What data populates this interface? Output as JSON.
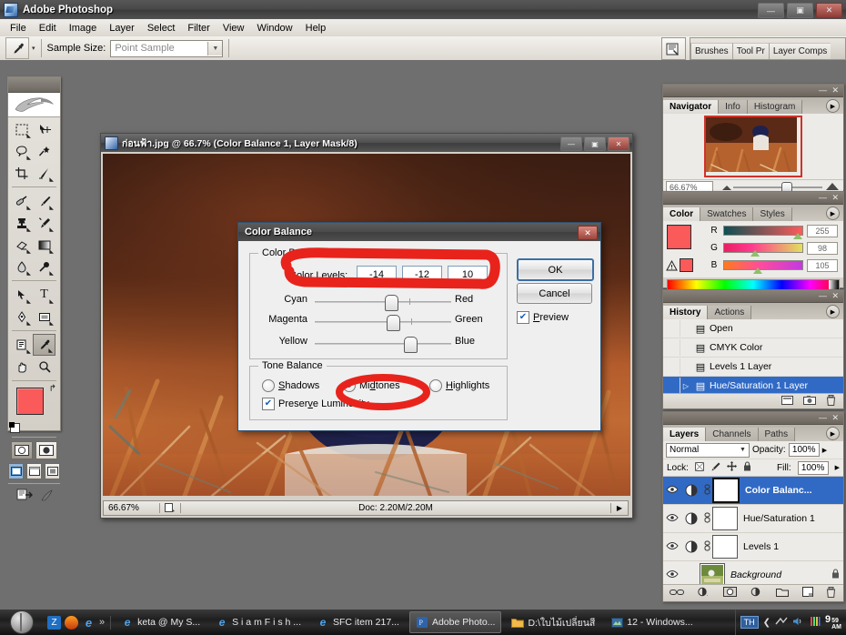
{
  "window": {
    "title": "Adobe Photoshop",
    "icon": "photoshop-icon",
    "minimize": "—",
    "maximize": "▣",
    "close": "✕"
  },
  "menu": {
    "items": [
      "File",
      "Edit",
      "Image",
      "Layer",
      "Select",
      "Filter",
      "View",
      "Window",
      "Help"
    ]
  },
  "options_bar": {
    "tool_icon": "eyedropper-icon",
    "tool_dropdown": "▾",
    "sample_size_label": "Sample Size:",
    "sample_size_value": "Point Sample",
    "dropdown_arrow": "▼"
  },
  "palette_well": {
    "icon": "palette-well-icon",
    "tabs": [
      "Brushes",
      "Tool Pr",
      "Layer Comps"
    ]
  },
  "toolbox": {
    "logo": "photoshop-feather-logo",
    "tools": [
      {
        "name": "marquee-tool",
        "glyph": "⬚",
        "has_corner": true
      },
      {
        "name": "move-tool",
        "glyph": "➤",
        "has_corner": false
      },
      {
        "name": "lasso-tool",
        "glyph": "◗",
        "has_corner": true
      },
      {
        "name": "magic-wand-tool",
        "glyph": "✳",
        "has_corner": false
      },
      {
        "name": "crop-tool",
        "glyph": "⌗",
        "has_corner": false
      },
      {
        "name": "slice-tool",
        "glyph": "✂",
        "has_corner": true
      },
      {
        "name": "healing-brush-tool",
        "glyph": "✒",
        "has_corner": true
      },
      {
        "name": "brush-tool",
        "glyph": "✏",
        "has_corner": true
      },
      {
        "name": "clone-stamp-tool",
        "glyph": "⎙",
        "has_corner": true
      },
      {
        "name": "history-brush-tool",
        "glyph": "✎",
        "has_corner": true
      },
      {
        "name": "eraser-tool",
        "glyph": "▱",
        "has_corner": true
      },
      {
        "name": "gradient-tool",
        "glyph": "▤",
        "has_corner": true
      },
      {
        "name": "blur-tool",
        "glyph": "💧",
        "has_corner": true
      },
      {
        "name": "dodge-tool",
        "glyph": "●",
        "has_corner": true
      },
      {
        "name": "path-selection-tool",
        "glyph": "➚",
        "has_corner": true
      },
      {
        "name": "type-tool",
        "glyph": "T",
        "has_corner": true
      },
      {
        "name": "pen-tool",
        "glyph": "✐",
        "has_corner": true
      },
      {
        "name": "rectangle-tool",
        "glyph": "▭",
        "has_corner": true
      },
      {
        "name": "notes-tool",
        "glyph": "▤",
        "has_corner": true
      },
      {
        "name": "eyedropper-tool",
        "glyph": "✒",
        "has_corner": true,
        "selected": true
      },
      {
        "name": "hand-tool",
        "glyph": "✋",
        "has_corner": false
      },
      {
        "name": "zoom-tool",
        "glyph": "🔍",
        "has_corner": false
      }
    ],
    "foreground_color": "#fa5a5a",
    "background_color": "#ffffff",
    "swap_icon": "↱",
    "quick_mask_normal": "◯",
    "quick_mask_on": "◉",
    "screen_modes": [
      "▣",
      "▢",
      "▣"
    ],
    "jump_to_imageready": "jump-to-imageready-icon"
  },
  "document": {
    "icon": "document-icon",
    "title": "ก่อนฟ้า.jpg @ 66.7% (Color Balance 1, Layer Mask/8)",
    "minimize": "—",
    "maximize": "▣",
    "close": "✕",
    "status": {
      "zoom": "66.67%",
      "icon": "doc-sizes-icon",
      "doc_info": "Doc: 2.20M/2.20M",
      "arrow": "▶"
    }
  },
  "dialog": {
    "title": "Color Balance",
    "close": "✕",
    "group_color_balance": "Color Balance",
    "color_levels_label": "Color Levels:",
    "color_levels": [
      "-14",
      "-12",
      "10"
    ],
    "sliders": [
      {
        "left": "Cyan",
        "right": "Red",
        "position": 48
      },
      {
        "left": "Magenta",
        "right": "Green",
        "position": 49
      },
      {
        "left": "Yellow",
        "right": "Blue",
        "position": 61
      }
    ],
    "group_tone_balance": "Tone Balance",
    "tone_options": [
      {
        "label": "Shadows",
        "selected": false
      },
      {
        "label": "Midtones",
        "selected": true
      },
      {
        "label": "Highlights",
        "selected": false
      }
    ],
    "preserve_luminosity": {
      "label": "Preserve Luminosity",
      "checked": true
    },
    "ok": "OK",
    "cancel": "Cancel",
    "preview": {
      "label": "Preview",
      "checked": true
    },
    "annotation_color": "#e8231c"
  },
  "navigator": {
    "tabs": [
      "Navigator",
      "Info",
      "Histogram"
    ],
    "active_tab": "Navigator",
    "zoom_value": "66.67%",
    "menu_icon": "panel-menu-icon",
    "minimize": "—",
    "close": "✕",
    "zoom_out_icon": "zoom-out-icon",
    "zoom_in_icon": "zoom-in-icon"
  },
  "color_panel": {
    "tabs": [
      "Color",
      "Swatches",
      "Styles"
    ],
    "active_tab": "Color",
    "channels": [
      {
        "letter": "R",
        "value": "255",
        "thumb": 92
      },
      {
        "letter": "G",
        "value": "98",
        "thumb": 38
      },
      {
        "letter": "B",
        "value": "105",
        "thumb": 41
      }
    ],
    "warning_icon": "out-of-gamut-warning-icon",
    "foreground": "#fa5a5a",
    "background": "#ffffff",
    "minimize": "—",
    "close": "✕",
    "menu_icon": "panel-menu-icon"
  },
  "history_panel": {
    "tabs": [
      "History",
      "Actions"
    ],
    "active_tab": "History",
    "items": [
      {
        "label": "Open",
        "selected": false
      },
      {
        "label": "CMYK Color",
        "selected": false
      },
      {
        "label": "Levels 1 Layer",
        "selected": false
      },
      {
        "label": "Hue/Saturation 1 Layer",
        "selected": true
      }
    ],
    "footer_icons": [
      "new-document-icon",
      "new-snapshot-icon",
      "delete-icon"
    ],
    "minimize": "—",
    "close": "✕",
    "menu_icon": "panel-menu-icon"
  },
  "layers_panel": {
    "tabs": [
      "Layers",
      "Channels",
      "Paths"
    ],
    "active_tab": "Layers",
    "blend_mode": "Normal",
    "opacity_label": "Opacity:",
    "opacity_value": "100%",
    "lock_label": "Lock:",
    "lock_icons": [
      "lock-transparency-icon",
      "lock-pixels-icon",
      "lock-position-icon",
      "lock-all-icon"
    ],
    "fill_label": "Fill:",
    "fill_value": "100%",
    "layers": [
      {
        "name": "Color Balanc...",
        "selected": true,
        "type": "adjustment",
        "linked": true,
        "locked": false
      },
      {
        "name": "Hue/Saturation 1",
        "selected": false,
        "type": "adjustment",
        "linked": true,
        "locked": false
      },
      {
        "name": "Levels 1",
        "selected": false,
        "type": "adjustment",
        "linked": true,
        "locked": false
      },
      {
        "name": "Background",
        "selected": false,
        "type": "image",
        "linked": false,
        "locked": true
      }
    ],
    "footer_icons": [
      "link-icon",
      "layer-style-icon",
      "layer-mask-icon",
      "adjustment-layer-icon",
      "new-group-icon",
      "new-layer-icon",
      "delete-layer-icon"
    ],
    "minimize": "—",
    "close": "✕",
    "menu_icon": "panel-menu-icon"
  },
  "taskbar": {
    "start": "start-orb",
    "quick_launch": [
      "quick-launch-icon-1",
      "firefox-icon",
      "internet-explorer-icon"
    ],
    "quick_launch_more": "»",
    "items": [
      {
        "label": "keta @ My S...",
        "icon": "internet-explorer-icon",
        "active": false
      },
      {
        "label": "S i a m F i s h ...",
        "icon": "internet-explorer-icon",
        "active": false
      },
      {
        "label": "SFC item 217...",
        "icon": "internet-explorer-icon",
        "active": false
      },
      {
        "label": "Adobe Photo...",
        "icon": "photoshop-icon",
        "active": true
      },
      {
        "label": "D:\\ใบไม้เปลี่ยนสี",
        "icon": "folder-icon",
        "active": false
      },
      {
        "label": "12 - Windows...",
        "icon": "media-player-icon",
        "active": false
      }
    ],
    "tray": {
      "language": "TH",
      "icons": [
        "show-desktop-icon",
        "network-icon",
        "volume-icon",
        "notify-icon"
      ],
      "time": "9",
      "time_minutes": "59",
      "ampm": "AM"
    }
  }
}
